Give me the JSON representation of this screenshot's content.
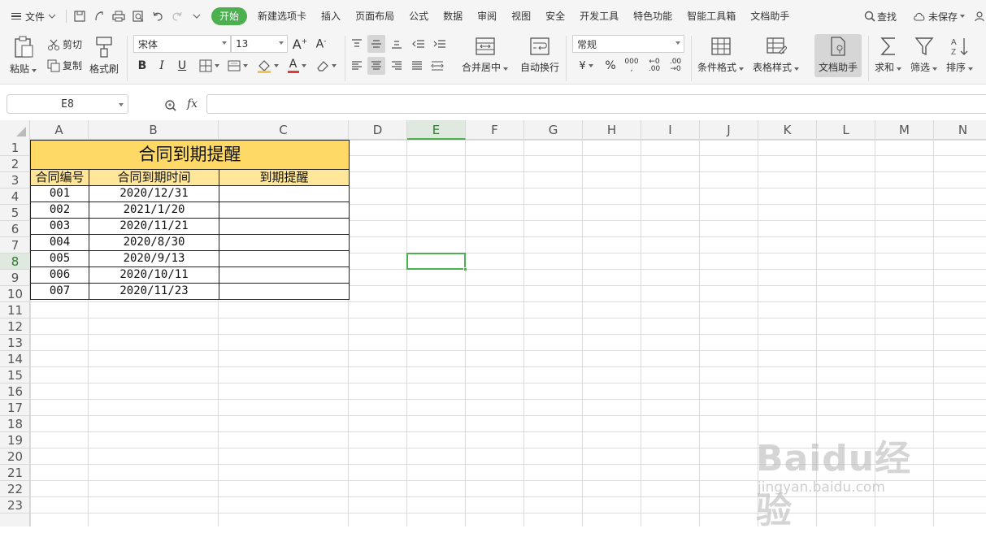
{
  "menubar": {
    "file_label": "文件",
    "tabs": [
      "开始",
      "新建选项卡",
      "插入",
      "页面布局",
      "公式",
      "数据",
      "审阅",
      "视图",
      "安全",
      "开发工具",
      "特色功能",
      "智能工具箱",
      "文档助手"
    ],
    "search_label": "查找",
    "unsaved_label": "未保存"
  },
  "ribbon": {
    "paste": "粘贴",
    "cut": "剪切",
    "copy": "复制",
    "format_painter": "格式刷",
    "font_name": "宋体",
    "font_size": "13",
    "merge_center": "合并居中",
    "wrap_text": "自动换行",
    "number_format": "常规",
    "conditional_format": "条件格式",
    "table_style": "表格样式",
    "doc_assistant": "文档助手",
    "sum": "求和",
    "filter": "筛选",
    "sort": "排序"
  },
  "formula_bar": {
    "name_box": "E8",
    "fx": "fx",
    "formula": ""
  },
  "sheet": {
    "columns": [
      "A",
      "B",
      "C",
      "D",
      "E",
      "F",
      "G",
      "H",
      "I",
      "J",
      "K",
      "L",
      "M",
      "N"
    ],
    "rows": [
      "1",
      "2",
      "3",
      "4",
      "5",
      "6",
      "7",
      "8",
      "9",
      "10",
      "11",
      "12",
      "13",
      "14",
      "15",
      "16",
      "17",
      "18",
      "19",
      "20",
      "21",
      "22",
      "23"
    ],
    "selected_column": "E",
    "selected_row": "8",
    "table": {
      "title": "合同到期提醒",
      "headers": [
        "合同编号",
        "合同到期时间",
        "到期提醒"
      ],
      "rows": [
        [
          "001",
          "2020/12/31",
          ""
        ],
        [
          "002",
          "2021/1/20",
          ""
        ],
        [
          "003",
          "2020/11/21",
          ""
        ],
        [
          "004",
          "2020/8/30",
          ""
        ],
        [
          "005",
          "2020/9/13",
          ""
        ],
        [
          "006",
          "2020/10/11",
          ""
        ],
        [
          "007",
          "2020/11/23",
          ""
        ]
      ]
    }
  },
  "watermark": {
    "brand": "Baidu经验",
    "url": "jingyan.baidu.com"
  },
  "colors": {
    "accent": "#4caf50",
    "title_fill": "#ffd966",
    "header_fill": "#ffe699"
  }
}
